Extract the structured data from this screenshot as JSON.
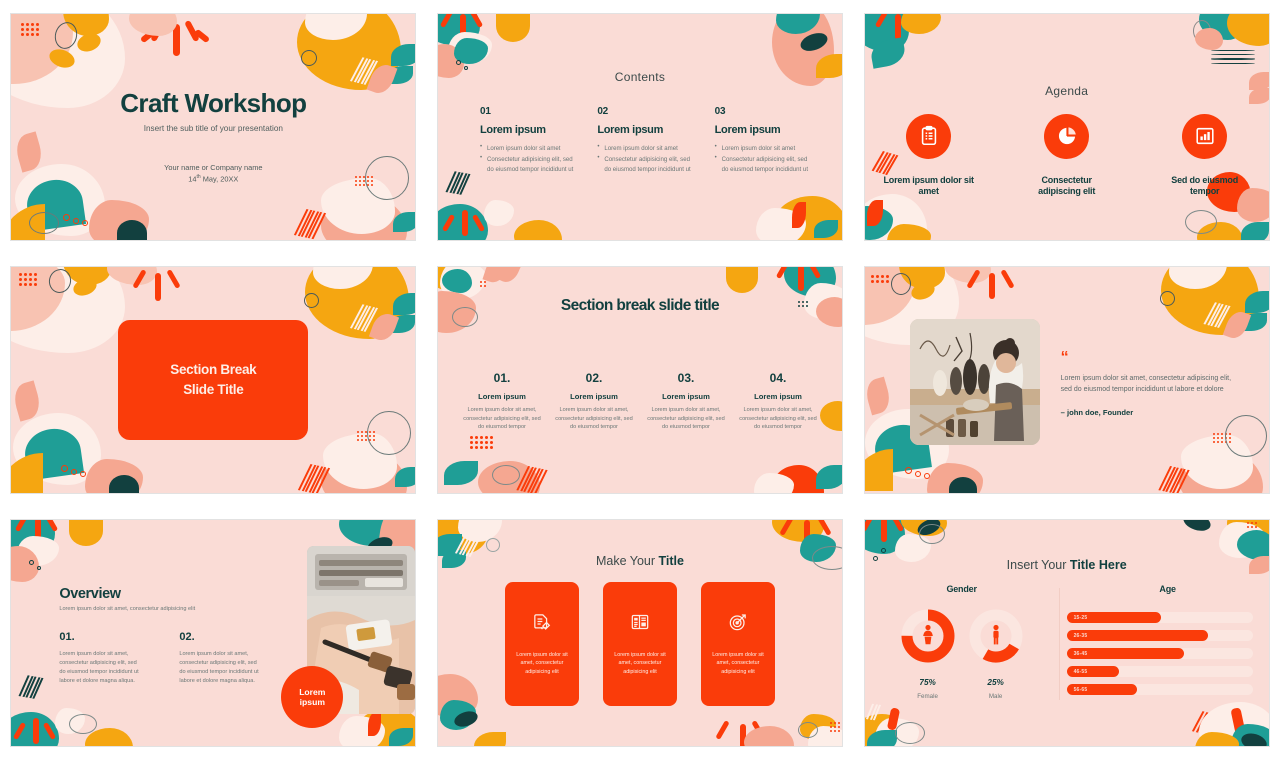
{
  "theme": {
    "bg_pink": "#FADCD6",
    "accent_orange": "#FA3C0A",
    "amber": "#F5A611",
    "teal": "#1F9E96",
    "dark_teal": "#12403F",
    "cream": "#FDEEE8",
    "salmon": "#F5A791"
  },
  "slides": [
    {
      "id": "title-slide",
      "title": "Craft Workshop",
      "subtitle": "Insert the sub title of your presentation",
      "author": "Your name or Company name",
      "date_prefix": "14",
      "date_suffix": "th",
      "date_rest": " May, 20XX"
    },
    {
      "id": "contents-slide",
      "heading": "Contents",
      "columns": [
        {
          "number": "01",
          "title": "Lorem ipsum",
          "bullets": [
            "Lorem ipsum dolor sit amet",
            "Consectetur adipisicing elit, sed do eiusmod tempor incididunt ut"
          ]
        },
        {
          "number": "02",
          "title": "Lorem ipsum",
          "bullets": [
            "Lorem ipsum dolor sit amet",
            "Consectetur adipisicing elit, sed do eiusmod tempor incididunt ut"
          ]
        },
        {
          "number": "03",
          "title": "Lorem ipsum",
          "bullets": [
            "Lorem ipsum dolor sit amet",
            "Consectetur adipisicing elit, sed do eiusmod tempor incididunt ut"
          ]
        }
      ]
    },
    {
      "id": "agenda-slide",
      "heading": "Agenda",
      "items": [
        {
          "icon": "clipboard-list-icon",
          "label": "Lorem ipsum dolor sit amet"
        },
        {
          "icon": "pie-chart-icon",
          "label": "Consectetur adipiscing elit"
        },
        {
          "icon": "bar-chart-icon",
          "label": "Sed do eiusmod tempor"
        }
      ]
    },
    {
      "id": "section-break-box-slide",
      "box_title_line1": "Section Break",
      "box_title_line2": "Slide Title"
    },
    {
      "id": "section-break-detail-slide",
      "heading": "Section break slide title",
      "columns": [
        {
          "number": "01.",
          "title": "Lorem ipsum",
          "body": "Lorem ipsum dolor sit amet, consectetur adipisicing elit, sed do eiusmod tempor"
        },
        {
          "number": "02.",
          "title": "Lorem ipsum",
          "body": "Lorem ipsum dolor sit amet, consectetur adipisicing elit, sed do eiusmod tempor"
        },
        {
          "number": "03.",
          "title": "Lorem ipsum",
          "body": "Lorem ipsum dolor sit amet, consectetur adipisicing elit, sed do eiusmod tempor"
        },
        {
          "number": "04.",
          "title": "Lorem ipsum",
          "body": "Lorem ipsum dolor sit amet, consectetur adipisicing elit, sed do eiusmod tempor"
        }
      ]
    },
    {
      "id": "quote-slide",
      "quote_mark": "“",
      "quote": "Lorem ipsum dolor sit amet, consectetur adipiscing elit, sed do eiusmod tempor incididunt ut labore et dolore",
      "attribution": "– john doe, Founder",
      "photo_alt": "woman-pottery-workshop-photo"
    },
    {
      "id": "overview-slide",
      "heading": "Overview",
      "subheading": "Lorem ipsum dolor sit amet, consectetur adipisicing elit",
      "columns": [
        {
          "number": "01.",
          "body": "Lorem ipsum dolor sit amet, consectetur adipisicing elit, sed do eiusmod tempor incididunt ut labore et dolore magna aliqua."
        },
        {
          "number": "02.",
          "body": "Lorem ipsum dolor sit amet, consectetur adipisicing elit, sed do eiusmod tempor incididunt ut labore et dolore magna aliqua."
        }
      ],
      "badge_line1": "Lorem",
      "badge_line2": "ipsum",
      "photo_alt": "hands-crafting-jewellery-photo"
    },
    {
      "id": "make-your-title-slide",
      "heading_normal": "Make Your ",
      "heading_bold": "Title",
      "cards": [
        {
          "icon": "document-edit-icon",
          "body": "Lorem ipsum dolor sit amet, consectetur adipisicing elit"
        },
        {
          "icon": "layout-columns-icon",
          "body": "Lorem ipsum dolor sit amet, consectetur adipisicing elit"
        },
        {
          "icon": "target-arrow-icon",
          "body": "Lorem ipsum dolor sit amet, consectetur adipisicing elit"
        }
      ]
    },
    {
      "id": "insert-your-title-here-slide",
      "heading_normal": "Insert Your ",
      "heading_bold": "Title Here",
      "chart_data": {
        "type": "bar",
        "title": "Insert Your Title Here",
        "charts": [
          {
            "type": "pie",
            "title": "Gender",
            "labels": [
              "Female",
              "Male"
            ],
            "values": [
              75,
              25
            ],
            "value_labels": [
              "75%",
              "25%"
            ],
            "icons": [
              "female-figure-icon",
              "male-figure-icon"
            ]
          },
          {
            "type": "bar",
            "title": "Age",
            "categories": [
              "15-25",
              "26-35",
              "36-45",
              "46-55",
              "56-65"
            ],
            "values": [
              51,
              76,
              63,
              28,
              38
            ],
            "xlabel": "",
            "ylabel": "",
            "xlim": [
              0,
              100
            ],
            "grid": false,
            "orientation": "horizontal"
          }
        ]
      }
    }
  ]
}
